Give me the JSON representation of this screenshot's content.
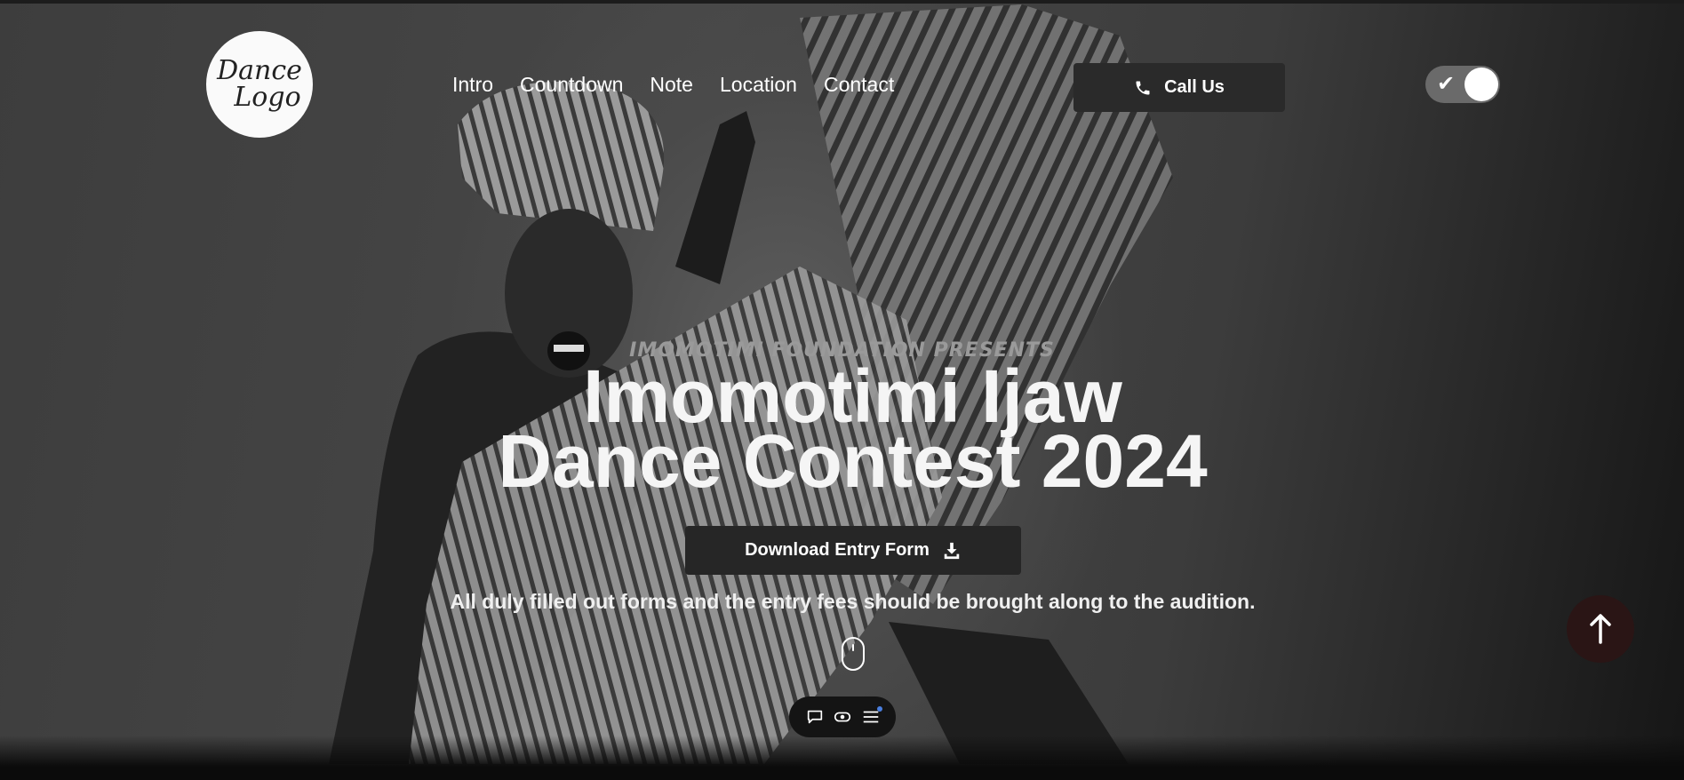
{
  "logo": {
    "line1": "Dance",
    "line2": "Logo"
  },
  "nav": {
    "items": [
      "Intro",
      "Countdown",
      "Note",
      "Location",
      "Contact"
    ]
  },
  "header": {
    "call_label": "Call Us",
    "call_icon": "phone-icon",
    "theme_toggle": {
      "state": "on",
      "icon": "check-icon"
    }
  },
  "hero": {
    "eyebrow": "IMOMOTIMI FOUNDATION PRESENTS",
    "title_line1": "Imomotimi Ijaw",
    "title_line2": "Dance Contest 2024",
    "download_label": "Download Entry Form",
    "download_icon": "download-icon",
    "note": "All duly filled out forms and the entry fees should be brought along to the audition.",
    "scroll_indicator": "mouse-icon"
  },
  "toolbar": {
    "icons": [
      "chat-icon",
      "eye-icon",
      "menu-icon"
    ]
  },
  "scroll_top": {
    "icon": "arrow-up-icon"
  },
  "colors": {
    "background": "#3a3a3a",
    "button_bg": "#2a2a2a",
    "scroll_top_bg": "#2a1515",
    "toggle_bg": "#6a6a6a",
    "notification_dot": "#4a7fe0"
  }
}
